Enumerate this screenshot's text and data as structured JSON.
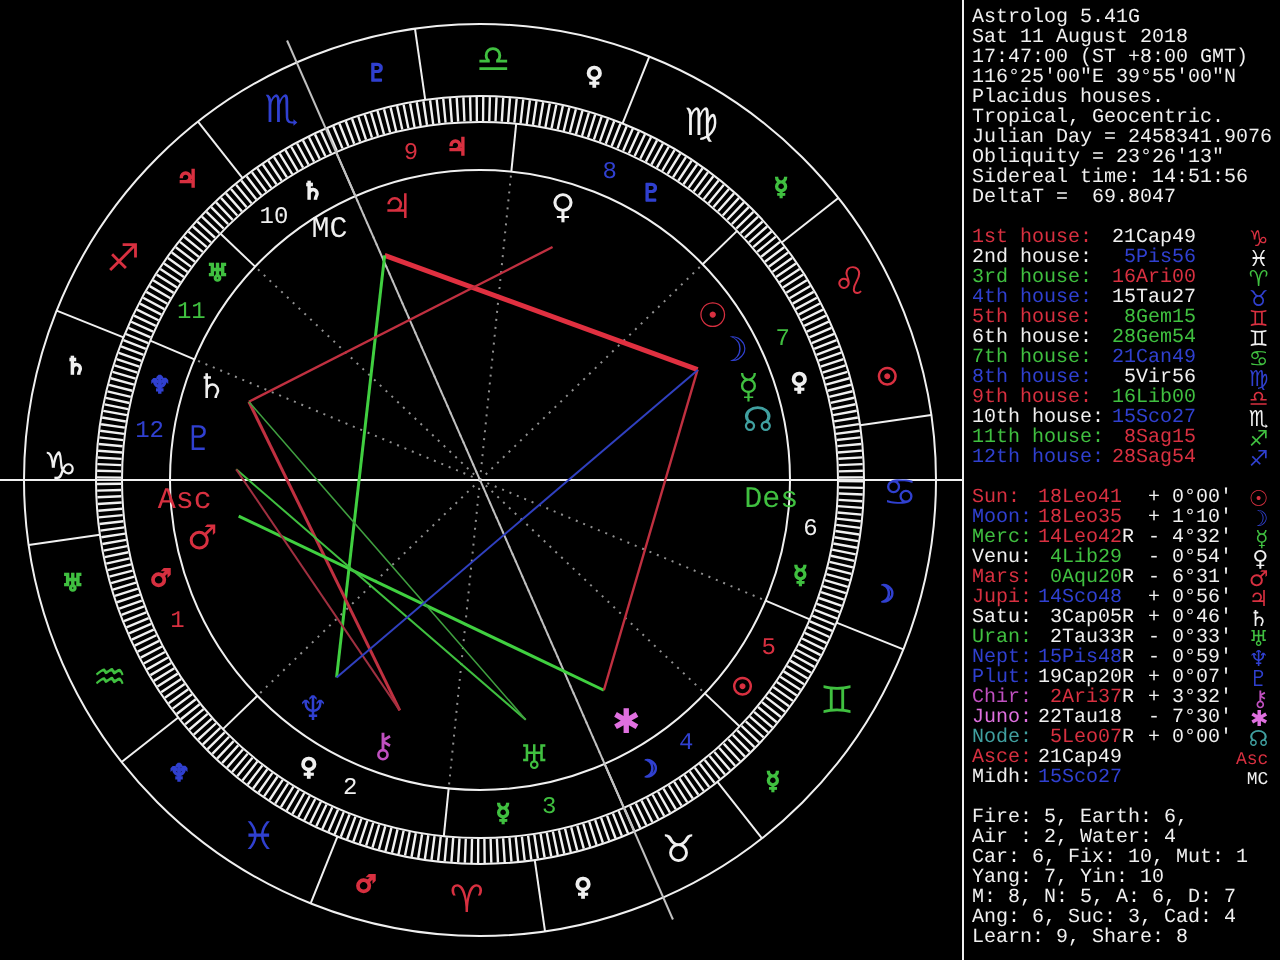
{
  "chart": {
    "signs": [
      {
        "glyph": "♈",
        "color": "#d83040",
        "ruler": {
          "glyph": "♂",
          "color": "#d83040"
        }
      },
      {
        "glyph": "♉",
        "color": "#f0f0f0",
        "ruler": {
          "glyph": "♀",
          "color": "#f0f0f0"
        }
      },
      {
        "glyph": "♊",
        "color": "#40c040",
        "ruler": {
          "glyph": "☿",
          "color": "#40c040"
        }
      },
      {
        "glyph": "♋",
        "color": "#3040d0",
        "ruler": {
          "glyph": "☽",
          "color": "#3040d0"
        }
      },
      {
        "glyph": "♌",
        "color": "#d83040",
        "ruler": {
          "glyph": "☉",
          "color": "#d83040"
        }
      },
      {
        "glyph": "♍",
        "color": "#f0f0f0",
        "ruler": {
          "glyph": "☿",
          "color": "#40c040"
        }
      },
      {
        "glyph": "♎",
        "color": "#40c040",
        "ruler": {
          "glyph": "♀",
          "color": "#f0f0f0"
        }
      },
      {
        "glyph": "♏",
        "color": "#3040d0",
        "ruler": {
          "glyph": "♇",
          "color": "#3040d0"
        }
      },
      {
        "glyph": "♐",
        "color": "#d83040",
        "ruler": {
          "glyph": "♃",
          "color": "#d83040"
        }
      },
      {
        "glyph": "♑",
        "color": "#f0f0f0",
        "ruler": {
          "glyph": "♄",
          "color": "#f0f0f0"
        }
      },
      {
        "glyph": "♒",
        "color": "#40c040",
        "ruler": {
          "glyph": "♅",
          "color": "#40c040"
        }
      },
      {
        "glyph": "♓",
        "color": "#3040d0",
        "ruler": {
          "glyph": "♆",
          "color": "#3040d0"
        }
      }
    ],
    "houses": [
      {
        "number": "1",
        "color": "#d83040",
        "ruler": {
          "glyph": "♂",
          "color": "#d83040"
        }
      },
      {
        "number": "2",
        "color": "#f0f0f0",
        "ruler": {
          "glyph": "♀",
          "color": "#f0f0f0"
        }
      },
      {
        "number": "3",
        "color": "#40c040",
        "ruler": {
          "glyph": "☿",
          "color": "#40c040"
        }
      },
      {
        "number": "4",
        "color": "#3040d0",
        "ruler": {
          "glyph": "☽",
          "color": "#3040d0"
        }
      },
      {
        "number": "5",
        "color": "#d83040",
        "ruler": {
          "glyph": "☉",
          "color": "#d83040"
        }
      },
      {
        "number": "6",
        "color": "#f0f0f0",
        "ruler": {
          "glyph": "☿",
          "color": "#40c040"
        }
      },
      {
        "number": "7",
        "color": "#40c040",
        "ruler": {
          "glyph": "♀",
          "color": "#f0f0f0"
        }
      },
      {
        "number": "8",
        "color": "#3040d0",
        "ruler": {
          "glyph": "♇",
          "color": "#3040d0"
        }
      },
      {
        "number": "9",
        "color": "#d83040",
        "ruler": {
          "glyph": "♃",
          "color": "#d83040"
        }
      },
      {
        "number": "10",
        "color": "#f0f0f0",
        "ruler": {
          "glyph": "♄",
          "color": "#f0f0f0"
        }
      },
      {
        "number": "11",
        "color": "#40c040",
        "ruler": {
          "glyph": "♅",
          "color": "#40c040"
        }
      },
      {
        "number": "12",
        "color": "#3040d0",
        "ruler": {
          "glyph": "♆",
          "color": "#3040d0"
        }
      }
    ],
    "planets": [
      {
        "glyph": "☉",
        "color": "#d83040"
      },
      {
        "glyph": "☽",
        "color": "#3040d0"
      },
      {
        "glyph": "☿",
        "color": "#40c040"
      },
      {
        "glyph": "♀",
        "color": "#f0f0f0"
      },
      {
        "glyph": "♂",
        "color": "#d83040"
      },
      {
        "glyph": "♃",
        "color": "#d83040"
      },
      {
        "glyph": "♄",
        "color": "#f0f0f0"
      },
      {
        "glyph": "♅",
        "color": "#40c040"
      },
      {
        "glyph": "♆",
        "color": "#3040d0"
      },
      {
        "glyph": "♇",
        "color": "#3040d0"
      },
      {
        "glyph": "⚷",
        "color": "#c050c0"
      },
      {
        "glyph": "✱",
        "color": "#e070e0"
      },
      {
        "glyph": "☊",
        "color": "#40a0a0"
      }
    ],
    "angles": [
      {
        "label": "Asc",
        "color": "#d83040"
      },
      {
        "label": "Des",
        "color": "#40c040"
      },
      {
        "label": "MC",
        "color": "#f0f0f0"
      }
    ]
  },
  "info": [
    "Astrolog 5.41G",
    "Sat 11 August 2018",
    "17:47:00 (ST +8:00 GMT)",
    "116°25'00\"E 39°55'00\"N",
    "Placidus houses.",
    "Tropical, Geocentric.",
    "Julian Day = 2458341.9076",
    "Obliquity = 23°26'13\"",
    "Sidereal time: 14:51:56",
    "DeltaT =  69.8047"
  ],
  "houses": [
    {
      "label": "1st house:",
      "color": "#d83040",
      "position": {
        "text": "21Cap49",
        "color": "#f0f0f0"
      },
      "glyph": "♑"
    },
    {
      "label": "2nd house:",
      "color": "#f0f0f0",
      "position": {
        "text": "5Pis56",
        "color": "#3040d0"
      },
      "glyph": "♓"
    },
    {
      "label": "3rd house:",
      "color": "#40c040",
      "position": {
        "text": "16Ari00",
        "color": "#d83040"
      },
      "glyph": "♈"
    },
    {
      "label": "4th house:",
      "color": "#3040d0",
      "position": {
        "text": "15Tau27",
        "color": "#f0f0f0"
      },
      "glyph": "♉"
    },
    {
      "label": "5th house:",
      "color": "#d83040",
      "position": {
        "text": "8Gem15",
        "color": "#40c040"
      },
      "glyph": "♊"
    },
    {
      "label": "6th house:",
      "color": "#f0f0f0",
      "position": {
        "text": "28Gem54",
        "color": "#40c040"
      },
      "glyph": "♊"
    },
    {
      "label": "7th house:",
      "color": "#40c040",
      "position": {
        "text": "21Can49",
        "color": "#3040d0"
      },
      "glyph": "♋"
    },
    {
      "label": "8th house:",
      "color": "#3040d0",
      "position": {
        "text": "5Vir56",
        "color": "#f0f0f0"
      },
      "glyph": "♍"
    },
    {
      "label": "9th house:",
      "color": "#d83040",
      "position": {
        "text": "16Lib00",
        "color": "#40c040"
      },
      "glyph": "♎"
    },
    {
      "label": "10th house:",
      "color": "#f0f0f0",
      "position": {
        "text": "15Sco27",
        "color": "#3040d0"
      },
      "glyph": "♏"
    },
    {
      "label": "11th house:",
      "color": "#40c040",
      "position": {
        "text": "8Sag15",
        "color": "#d83040"
      },
      "glyph": "♐"
    },
    {
      "label": "12th house:",
      "color": "#3040d0",
      "position": {
        "text": "28Sag54",
        "color": "#d83040"
      },
      "glyph": "♐"
    }
  ],
  "planets": [
    {
      "label": "Sun:",
      "color": "#d83040",
      "position": {
        "text": "18Leo41",
        "color": "#d83040"
      },
      "aspect": "+ 0°00'",
      "glyph": "☉"
    },
    {
      "label": "Moon:",
      "color": "#3040d0",
      "position": {
        "text": "18Leo35",
        "color": "#d83040"
      },
      "aspect": "+ 1°10'",
      "glyph": "☽"
    },
    {
      "label": "Merc:",
      "color": "#40c040",
      "position": {
        "text": "14Leo42",
        "color": "#d83040"
      },
      "flag": "R",
      "aspect": "- 4°32'",
      "glyph": "☿"
    },
    {
      "label": "Venu:",
      "color": "#f0f0f0",
      "position": {
        "text": "4Lib29",
        "color": "#40c040"
      },
      "aspect": "- 0°54'",
      "glyph": "♀"
    },
    {
      "label": "Mars:",
      "color": "#d83040",
      "position": {
        "text": "0Aqu20",
        "color": "#40c040"
      },
      "flag": "R",
      "aspect": "- 6°31'",
      "glyph": "♂"
    },
    {
      "label": "Jupi:",
      "color": "#d83040",
      "position": {
        "text": "14Sco48",
        "color": "#3040d0"
      },
      "aspect": "+ 0°56'",
      "glyph": "♃"
    },
    {
      "label": "Satu:",
      "color": "#f0f0f0",
      "position": {
        "text": "3Cap05",
        "color": "#f0f0f0"
      },
      "flag": "R",
      "aspect": "+ 0°46'",
      "glyph": "♄"
    },
    {
      "label": "Uran:",
      "color": "#40c040",
      "position": {
        "text": "2Tau33",
        "color": "#f0f0f0"
      },
      "flag": "R",
      "aspect": "- 0°33'",
      "glyph": "♅"
    },
    {
      "label": "Nept:",
      "color": "#3040d0",
      "position": {
        "text": "15Pis48",
        "color": "#3040d0"
      },
      "flag": "R",
      "aspect": "- 0°59'",
      "glyph": "♆"
    },
    {
      "label": "Plut:",
      "color": "#3040d0",
      "position": {
        "text": "19Cap20",
        "color": "#f0f0f0"
      },
      "flag": "R",
      "aspect": "+ 0°07'",
      "glyph": "♇"
    },
    {
      "label": "Chir:",
      "color": "#c050c0",
      "position": {
        "text": "2Ari37",
        "color": "#d83040"
      },
      "flag": "R",
      "aspect": "+ 3°32'",
      "glyph": "⚷"
    },
    {
      "label": "Juno:",
      "color": "#e070e0",
      "position": {
        "text": "22Tau18",
        "color": "#f0f0f0"
      },
      "aspect": "- 7°30'",
      "glyph": "✱"
    },
    {
      "label": "Node:",
      "color": "#40a0a0",
      "position": {
        "text": "5Leo07",
        "color": "#d83040"
      },
      "flag": "R",
      "aspect": "+ 0°00'",
      "glyph": "☊"
    },
    {
      "label": "Asce:",
      "color": "#d83040",
      "position": {
        "text": "21Cap49",
        "color": "#f0f0f0"
      },
      "glyph": "Asc"
    },
    {
      "label": "Midh:",
      "color": "#f0f0f0",
      "position": {
        "text": "15Sco27",
        "color": "#3040d0"
      },
      "glyph": "MC"
    }
  ],
  "summary": [
    "Fire: 5, Earth: 6,",
    "Air : 2, Water: 4",
    "Car: 6, Fix: 10, Mut: 1",
    "Yang: 7, Yin: 10",
    "M: 8, N: 5, A: 6, D: 7",
    "Ang: 6, Suc: 3, Cad: 4",
    "Learn: 9, Share: 8"
  ]
}
